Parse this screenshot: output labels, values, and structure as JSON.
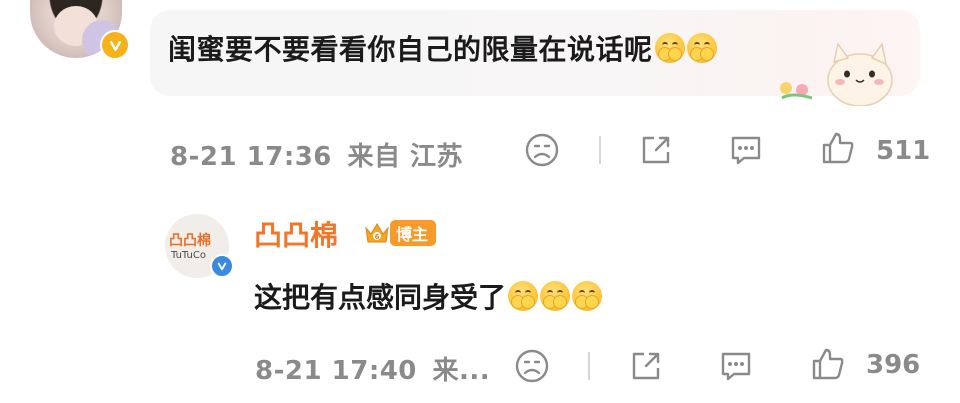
{
  "comment": {
    "text": "闺蜜要不要看看你自己的限量在说话呢",
    "date": "8-21",
    "time": "17:36",
    "location": "来自 江苏",
    "like_count": "511",
    "avatar_badge_color": "#f5b21a",
    "emojis": [
      "cry-hands-emoji",
      "cry-hands-emoji"
    ],
    "sticker": "cat-sticker"
  },
  "reply": {
    "username": "凸凸棉",
    "role_badge": "博主",
    "avatar_brand": "凸凸棉",
    "avatar_sub": "TuTuCo",
    "text": "这把有点感同身受了",
    "date": "8-21",
    "time": "17:40",
    "location_truncated": "来...",
    "like_count": "396",
    "name_color": "#f0772a",
    "verify_color": "#3a8be0",
    "emojis": [
      "cry-hands-emoji",
      "cry-hands-emoji",
      "cry-hands-emoji"
    ]
  },
  "icons": {
    "dislike": "frown-face-icon",
    "share": "share-arrow-icon",
    "reply": "comment-bubble-icon",
    "like": "thumbs-up-icon"
  }
}
